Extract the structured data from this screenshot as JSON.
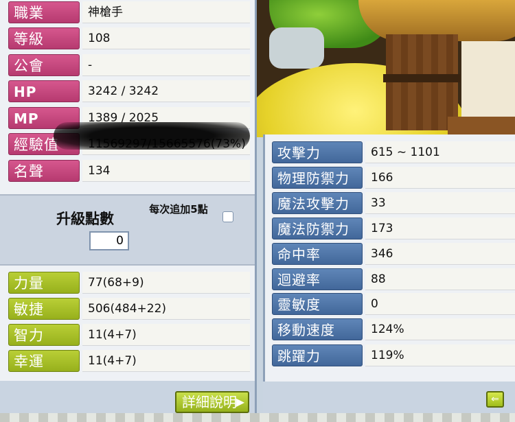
{
  "profile": [
    {
      "label": "職業",
      "value": "神槍手"
    },
    {
      "label": "等級",
      "value": "108"
    },
    {
      "label": "公會",
      "value": "-"
    },
    {
      "label": "HP",
      "value": "3242 / 3242"
    },
    {
      "label": "MP",
      "value": "1389 / 2025"
    },
    {
      "label": "經驗值",
      "value": "11569297/15665576(73%)"
    },
    {
      "label": "名聲",
      "value": "134"
    }
  ],
  "ability_points": {
    "label": "升級點數",
    "value": "0",
    "auto_label": "每次追加5點"
  },
  "stats": [
    {
      "label": "力量",
      "value": "77(68+9)"
    },
    {
      "label": "敏捷",
      "value": "506(484+22)"
    },
    {
      "label": "智力",
      "value": "11(4+7)"
    },
    {
      "label": "幸運",
      "value": "11(4+7)"
    }
  ],
  "detail_button": {
    "label": "詳細說明",
    "arrow": "▶"
  },
  "combat": [
    {
      "label": "攻擊力",
      "value": "615 ~ 1101"
    },
    {
      "label": "物理防禦力",
      "value": "166"
    },
    {
      "label": "魔法攻擊力",
      "value": "33"
    },
    {
      "label": "魔法防禦力",
      "value": "173"
    },
    {
      "label": "命中率",
      "value": "346"
    },
    {
      "label": "迴避率",
      "value": "88"
    },
    {
      "label": "靈敏度",
      "value": "0"
    },
    {
      "label": "移動速度",
      "value": "124%"
    },
    {
      "label": "跳躍力",
      "value": "119%"
    }
  ],
  "back_button": {
    "icon": "back-arrow-icon",
    "glyph": "⇐"
  },
  "colors": {
    "profile_label": "#c24a7e",
    "stat_label": "#a8c028",
    "combat_label": "#4f76a8",
    "panel_bg": "#eef1f5"
  }
}
